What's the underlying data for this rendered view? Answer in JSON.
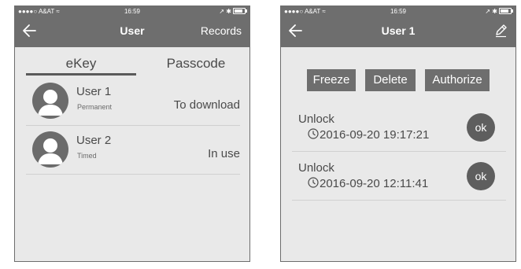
{
  "left_screen": {
    "status_bar": {
      "carrier": "●●●●○ A&AT ≈",
      "time": "16:59",
      "right": "↗ ✱"
    },
    "nav": {
      "title": "User",
      "records_label": "Records"
    },
    "tabs": [
      {
        "label": "eKey"
      },
      {
        "label": "Passcode"
      }
    ],
    "users": [
      {
        "name": "User 1",
        "type": "Permanent",
        "status": "To download"
      },
      {
        "name": "User 2",
        "type": "Timed",
        "status": "In use"
      }
    ]
  },
  "right_screen": {
    "status_bar": {
      "carrier": "●●●●○ A&AT ≈",
      "time": "16:59",
      "right": "↗ ✱"
    },
    "nav": {
      "title": "User 1"
    },
    "actions": {
      "freeze": "Freeze",
      "delete": "Delete",
      "authorize": "Authorize"
    },
    "records": [
      {
        "event": "Unlock",
        "time": "2016-09-20 19:17:21",
        "badge": "ok"
      },
      {
        "event": "Unlock",
        "time": "2016-09-20 12:11:41",
        "badge": "ok"
      }
    ]
  }
}
